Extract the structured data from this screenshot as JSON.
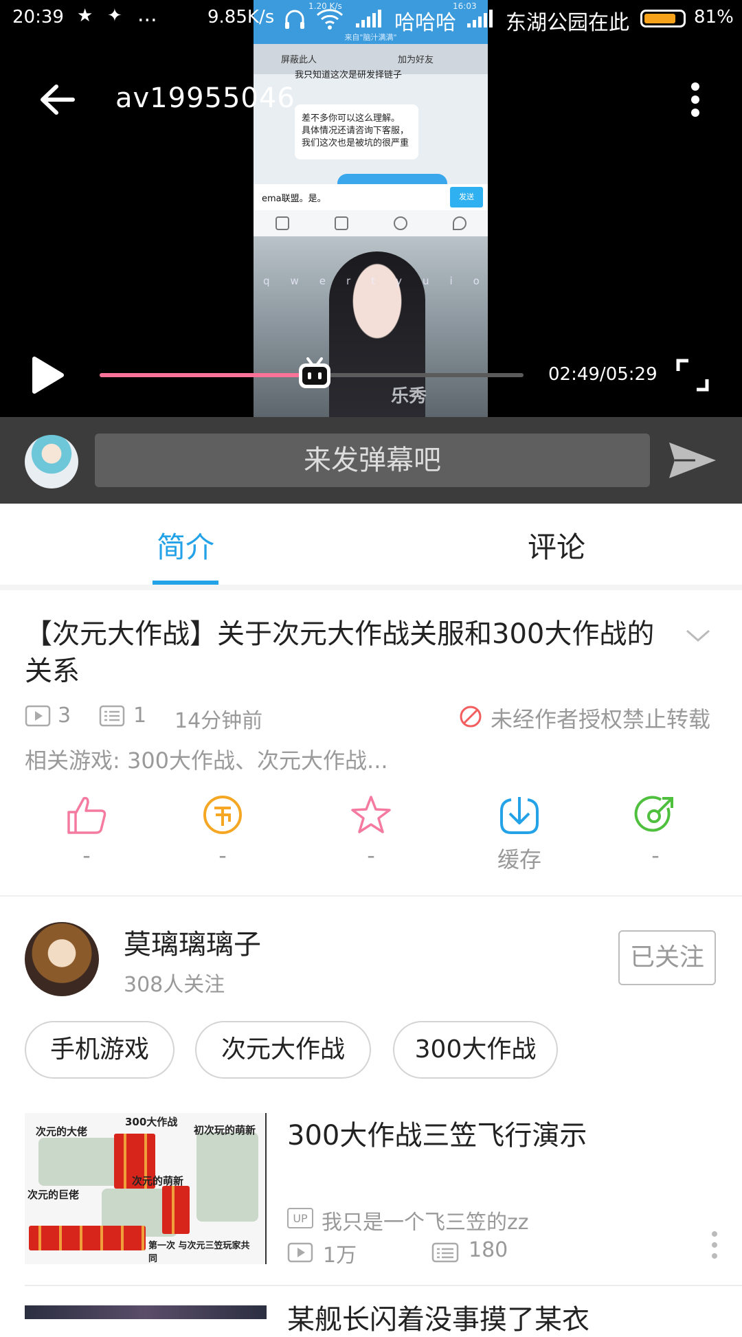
{
  "status_bar": {
    "time": "20:39",
    "dots": "...",
    "speed": "9.85K/s",
    "carrier": "哈哈哈",
    "wifi_name": "东湖公园在此",
    "battery": "81%",
    "battery_level": 0.81
  },
  "video": {
    "title": "av19955046",
    "time": "02:49/05:29",
    "progress": 0.508,
    "frame": {
      "status": "1.20 K/s",
      "status_time": "16:03",
      "chat_header": "来自\"脑汁满满\"",
      "block_label": "屏蔽此人",
      "add_friend_label": "加为好友",
      "message_1": "我只知道这次是研发择链子",
      "message_2": "差不多你可以这么理解。 具体情况还请咨询下客服，我们这次也是被坑的很严重",
      "input_text": "ema联盟。是。",
      "send_label": "发送",
      "watermark": "乐秀"
    }
  },
  "danmaku": {
    "placeholder": "来发弹幕吧"
  },
  "tabs": [
    {
      "label": "简介",
      "active": true
    },
    {
      "label": "评论",
      "active": false
    }
  ],
  "intro": {
    "title": "【次元大作战】关于次元大作战关服和300大作战的关系",
    "play_count": "3",
    "danmaku_count": "1",
    "time_ago": "14分钟前",
    "no_repost": "未经作者授权禁止转载",
    "related_games": "相关游戏: 300大作战、次元大作战..."
  },
  "actions": [
    {
      "name": "like",
      "icon": "thumbs-up-icon",
      "label": "-",
      "color": "#f47aa0"
    },
    {
      "name": "coin",
      "icon": "coin-icon",
      "label": "-",
      "color": "#f5a623"
    },
    {
      "name": "favorite",
      "icon": "star-icon",
      "label": "-",
      "color": "#f47aa0"
    },
    {
      "name": "cache",
      "icon": "download-icon",
      "label": "缓存",
      "color": "#23a2e8"
    },
    {
      "name": "share",
      "icon": "share-icon",
      "label": "-",
      "color": "#4fbf3e"
    }
  ],
  "uploader": {
    "name": "莫璃璃璃子",
    "fans": "308人关注",
    "follow_label": "已关注"
  },
  "tags": [
    "手机游戏",
    "次元大作战",
    "300大作战"
  ],
  "recommend": [
    {
      "title": "300大作战三笠飞行演示",
      "up_badge": "UP",
      "up_name": "我只是一个飞三笠的zz",
      "plays": "1万",
      "danmaku": "180",
      "thumb_text": {
        "top": "300大作战",
        "a": "次元的大佬",
        "b": "初次玩的萌新",
        "c": "次元的萌新",
        "d": "次元的巨佬",
        "bottom": "第一次 与次元三笠玩家共同"
      }
    },
    {
      "title": "某舰长闪着没事摸了某衣"
    }
  ],
  "colors": {
    "accent": "#23a2e8",
    "pink": "#fb7299"
  }
}
